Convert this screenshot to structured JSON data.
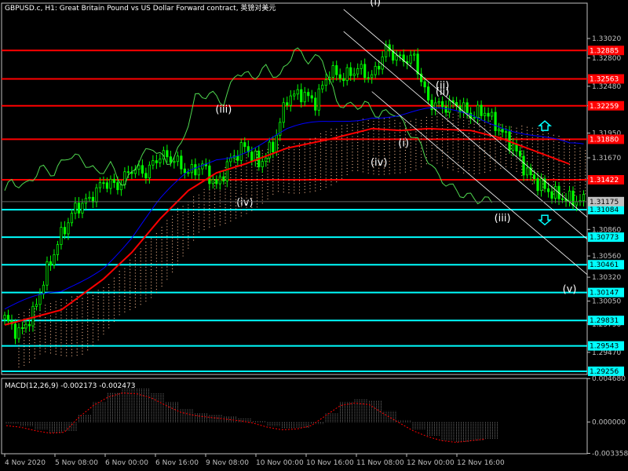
{
  "header": {
    "symbol_label": "GBPUSD.c, H1:",
    "description": "Great Britain Pound vs US Dollar Forward contract, 英镑对美元"
  },
  "colors": {
    "background": "#000000",
    "candles": "#00ff00",
    "axis": "#c0c0c0",
    "grid": "#646464",
    "red_level": "#ff0000",
    "cyan_level": "#00ffff",
    "kijun": "#ff0000",
    "tenkan": "#ff0000",
    "chikou": "#4fd84f",
    "senkou_blue": "#0000ff",
    "cloud_fill": "#f0b48c",
    "macd_hist": "#c0c0c0",
    "macd_signal": "#ff0000",
    "channel": "#ffffff",
    "wave_label": "#ffffff",
    "arrow": "#00ffff"
  },
  "chart_data": [
    {
      "type": "line",
      "name": "price",
      "title": "GBPUSD.c, H1",
      "ylim": [
        1.2922,
        1.3342
      ],
      "y_ticks": [
        "1.33020",
        "1.32800",
        "1.32480",
        "1.32260",
        "1.31950",
        "1.31670",
        "1.31440",
        "1.30860",
        "1.30560",
        "1.30320",
        "1.30050",
        "1.29790",
        "1.29470"
      ],
      "x_ticks": [
        "4 Nov 2020",
        "5 Nov 08:00",
        "6 Nov 00:00",
        "6 Nov 16:00",
        "9 Nov 08:00",
        "10 Nov 00:00",
        "10 Nov 16:00",
        "11 Nov 08:00",
        "12 Nov 00:00",
        "12 Nov 16:00"
      ],
      "current_price": "1.31175",
      "levels_red": [
        "1.32885",
        "1.32563",
        "1.32259",
        "1.31880",
        "1.31422"
      ],
      "levels_cyan": [
        "1.31084",
        "1.30773",
        "1.30461",
        "1.30147",
        "1.29831",
        "1.29543",
        "1.29256"
      ],
      "wave_labels": [
        "(i)",
        "(ii)",
        "(iii)",
        "(iv)",
        "(v)",
        "(iii)",
        "(iv)",
        "(i)",
        "(ii)"
      ],
      "close_path": [
        [
          0,
          1.2985
        ],
        [
          4,
          1.2968
        ],
        [
          8,
          1.299
        ],
        [
          12,
          1.304
        ],
        [
          16,
          1.308
        ],
        [
          20,
          1.311
        ],
        [
          24,
          1.312
        ],
        [
          28,
          1.314
        ],
        [
          32,
          1.3135
        ],
        [
          36,
          1.3155
        ],
        [
          40,
          1.315
        ],
        [
          44,
          1.317
        ],
        [
          48,
          1.3165
        ],
        [
          52,
          1.315
        ],
        [
          56,
          1.3158
        ],
        [
          60,
          1.3135
        ],
        [
          64,
          1.3165
        ],
        [
          68,
          1.318
        ],
        [
          72,
          1.316
        ],
        [
          76,
          1.318
        ],
        [
          80,
          1.3235
        ],
        [
          84,
          1.324
        ],
        [
          88,
          1.323
        ],
        [
          92,
          1.3265
        ],
        [
          96,
          1.3258
        ],
        [
          100,
          1.3268
        ],
        [
          104,
          1.3258
        ],
        [
          108,
          1.329
        ],
        [
          112,
          1.3278
        ],
        [
          116,
          1.328
        ],
        [
          120,
          1.323
        ],
        [
          124,
          1.3225
        ],
        [
          128,
          1.3228
        ],
        [
          132,
          1.3215
        ],
        [
          136,
          1.322
        ],
        [
          140,
          1.32
        ],
        [
          144,
          1.318
        ],
        [
          148,
          1.315
        ],
        [
          152,
          1.3135
        ],
        [
          156,
          1.3125
        ],
        [
          160,
          1.312
        ],
        [
          164,
          1.3118
        ]
      ],
      "kijun": [
        [
          0,
          1.2978
        ],
        [
          16,
          1.2995
        ],
        [
          28,
          1.303
        ],
        [
          36,
          1.306
        ],
        [
          44,
          1.3098
        ],
        [
          52,
          1.313
        ],
        [
          60,
          1.315
        ],
        [
          68,
          1.316
        ],
        [
          80,
          1.3178
        ],
        [
          92,
          1.3188
        ],
        [
          104,
          1.32
        ],
        [
          112,
          1.3198
        ],
        [
          120,
          1.32
        ],
        [
          132,
          1.3198
        ],
        [
          140,
          1.319
        ],
        [
          150,
          1.3175
        ],
        [
          160,
          1.316
        ]
      ]
    },
    {
      "type": "bar",
      "name": "MACD(12,26,9)",
      "title": "MACD(12,26,9) -0.002173 -0.002473",
      "macd_label": "MACD(12,26,9)",
      "macd_main": "-0.002173",
      "macd_signal": "-0.002473",
      "ylim": [
        -0.0034,
        0.0047
      ],
      "y_ticks": [
        "0.004680",
        "0.000000",
        "-0.003358"
      ],
      "hist": [
        -0.0002,
        -0.0004,
        -0.0008,
        -0.0011,
        -0.001,
        0.0008,
        0.0022,
        0.0032,
        0.0037,
        0.0036,
        0.0031,
        0.0022,
        0.0014,
        0.001,
        0.0008,
        0.0006,
        0.0004,
        0.0001,
        -0.0004,
        -0.0007,
        -0.0006,
        -0.0002,
        0.001,
        0.0022,
        0.0025,
        0.0023,
        0.0012,
        0.0002,
        -0.0008,
        -0.0015,
        -0.002,
        -0.0022,
        -0.002,
        -0.0018
      ]
    }
  ]
}
